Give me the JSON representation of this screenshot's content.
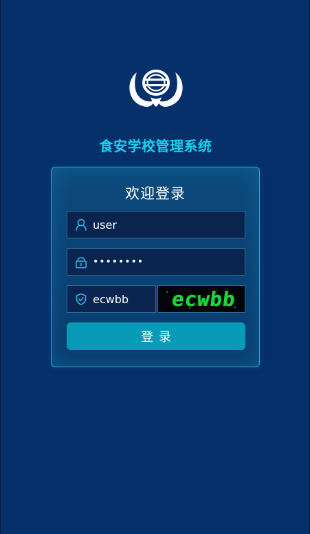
{
  "app": {
    "title": "食安学校管理系统"
  },
  "login": {
    "heading": "欢迎登录",
    "username": {
      "value": "user",
      "icon": "user-icon"
    },
    "password": {
      "value": "••••••••",
      "icon": "lock-icon"
    },
    "captcha": {
      "value": "ecwbb",
      "icon": "shield-check-icon",
      "image_text": "ecwbb"
    },
    "submit_label": "登录"
  },
  "colors": {
    "background": "#05306a",
    "title": "#19d2ef",
    "button": "#079bb8",
    "captcha_text": "#23d33a"
  }
}
